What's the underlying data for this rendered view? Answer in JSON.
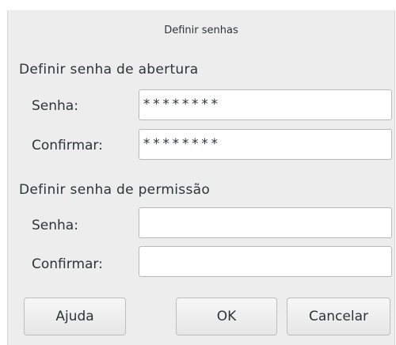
{
  "dialog": {
    "title": "Definir senhas"
  },
  "open_password": {
    "section_title": "Definir senha de abertura",
    "password_label": "Senha:",
    "password_value": "********",
    "confirm_label": "Confirmar:",
    "confirm_value": "********"
  },
  "permission_password": {
    "section_title": "Definir senha de permissão",
    "password_label": "Senha:",
    "password_value": "",
    "confirm_label": "Confirmar:",
    "confirm_value": ""
  },
  "buttons": {
    "help_label": "Ajuda",
    "ok_label": "OK",
    "cancel_label": "Cancelar"
  }
}
